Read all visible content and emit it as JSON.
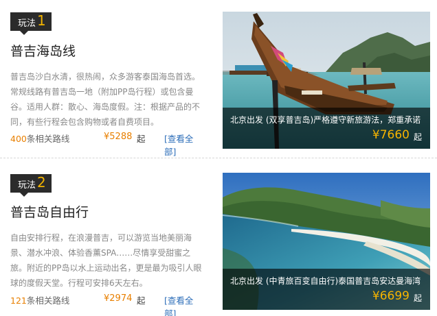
{
  "items": [
    {
      "tag_label": "玩法",
      "tag_number": "1",
      "title": "普吉海岛线",
      "desc": "普吉岛沙白水清，很热闹，众多游客泰国海岛首选。常规线路有普吉岛一地（附加PP岛行程）或包含曼谷。适用人群：散心、海岛度假。注：根据产品的不同，有些行程会包含购物或者自费项目。",
      "count_num": "400",
      "count_suffix": "条相关路线",
      "price": "¥5288",
      "price_unit": "起",
      "view_all": "[查看全部]",
      "photo_caption": "北京出发 (双享普吉岛)严格遵守新旅游法，郑重承诺",
      "photo_price": "¥7660",
      "photo_price_unit": "起"
    },
    {
      "tag_label": "玩法",
      "tag_number": "2",
      "title": "普吉岛自由行",
      "desc": "自由安排行程，在浪漫普吉，可以游览当地美丽海景、潜水冲浪、体验香薰SPA……尽情享受甜蜜之旅。附近的PP岛以水上运动出名，更是最为吸引人眼球的度假天堂。行程可安排6天左右。",
      "count_num": "121",
      "count_suffix": "条相关路线",
      "price": "¥2974",
      "price_unit": "起",
      "view_all": "[查看全部]",
      "photo_caption": "北京出发 (中青旅百变自由行)泰国普吉岛安达曼海湾",
      "photo_price": "¥6699",
      "photo_price_unit": "起"
    }
  ],
  "icons": [
    "longtail-boat-photo",
    "beach-bay-photo"
  ]
}
